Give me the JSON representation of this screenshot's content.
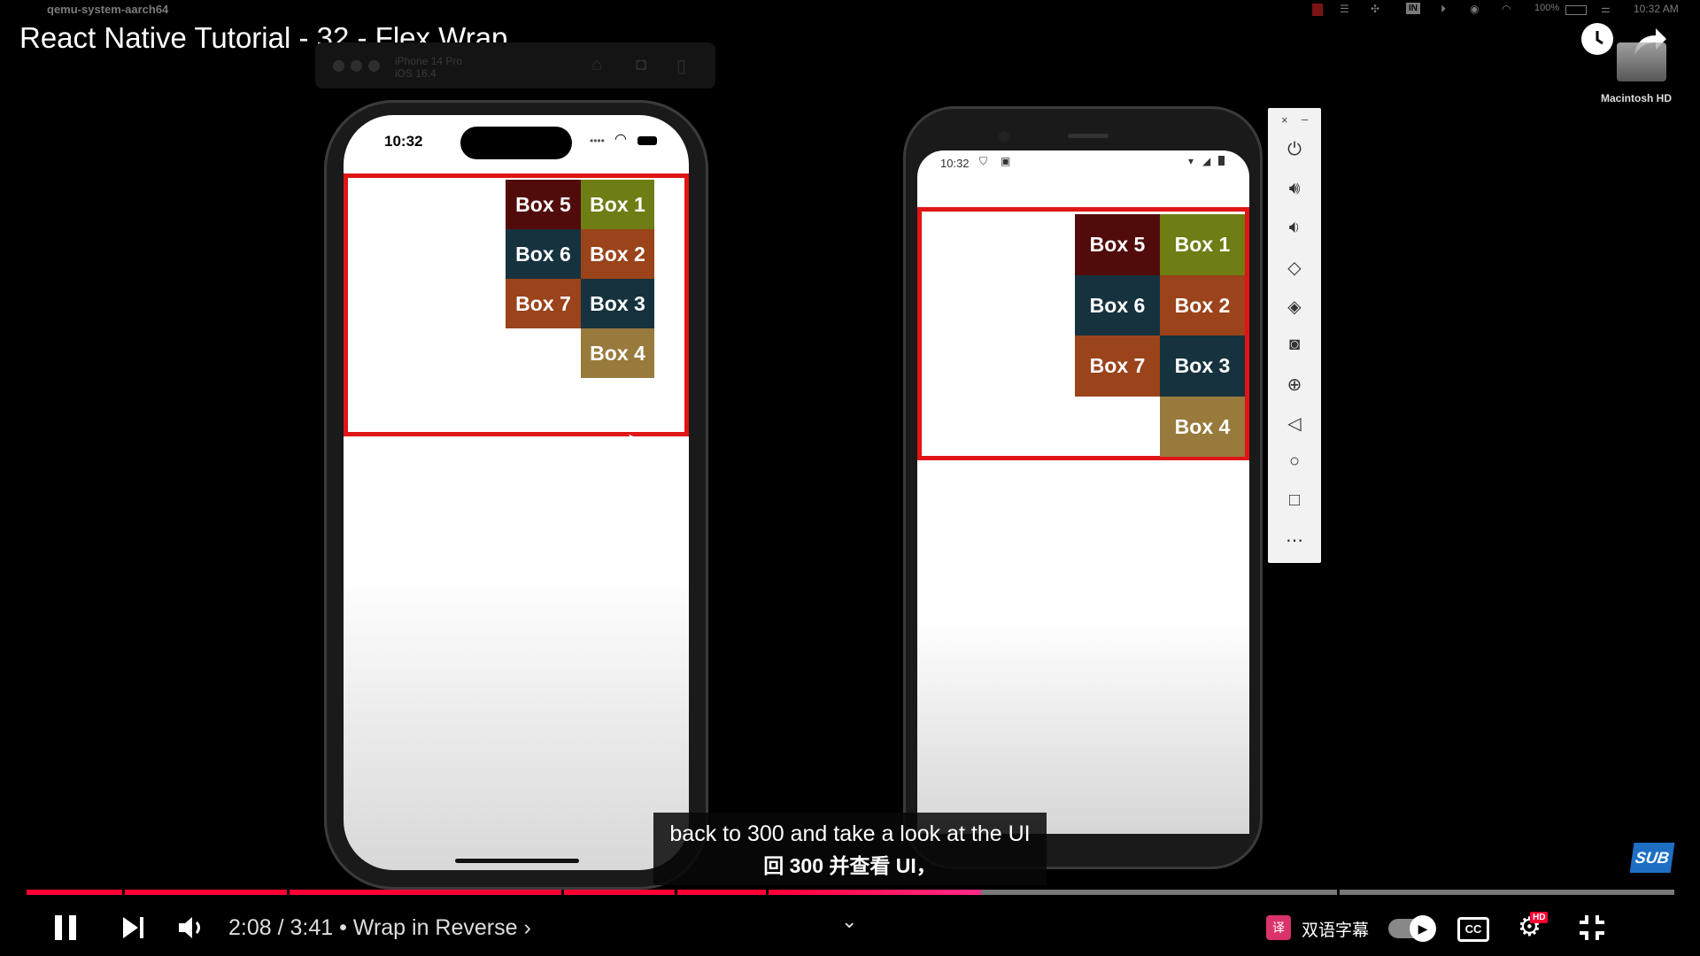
{
  "menubar": {
    "app_name": "qemu-system-aarch64",
    "clock": "10:32 AM",
    "battery": "100%",
    "input_badge": "IN"
  },
  "video": {
    "title": "React Native Tutorial - 32 - Flex Wrap"
  },
  "simulator": {
    "device": "iPhone 14 Pro",
    "os": "iOS 16.4"
  },
  "ios": {
    "time": "10:32"
  },
  "android": {
    "time": "10:32"
  },
  "boxes": [
    {
      "label": "Box 1",
      "color": "#6e7d14"
    },
    {
      "label": "Box 2",
      "color": "#9b431b"
    },
    {
      "label": "Box 3",
      "color": "#16323e"
    },
    {
      "label": "Box 4",
      "color": "#987a3c"
    },
    {
      "label": "Box 5",
      "color": "#520b0b"
    },
    {
      "label": "Box 6",
      "color": "#16323e"
    },
    {
      "label": "Box 7",
      "color": "#9b431b"
    }
  ],
  "desktop": {
    "disk_label": "Macintosh HD"
  },
  "subtitles": {
    "english": "back to 300 and take a look at the UI",
    "chinese": "回 300 并查看 UI，"
  },
  "player": {
    "current_time": "2:08",
    "duration": "3:41",
    "chapter": "Wrap in Reverse",
    "time_display": "2:08 / 3:41 • Wrap in Reverse ›",
    "played_fraction": 0.58,
    "bilingual_label": "双语字幕",
    "hd_badge": "HD",
    "cc_label": "CC",
    "sub_badge": "SUB"
  },
  "colors": {
    "progress_played": "#ff0033",
    "frame_border": "#e01515"
  }
}
